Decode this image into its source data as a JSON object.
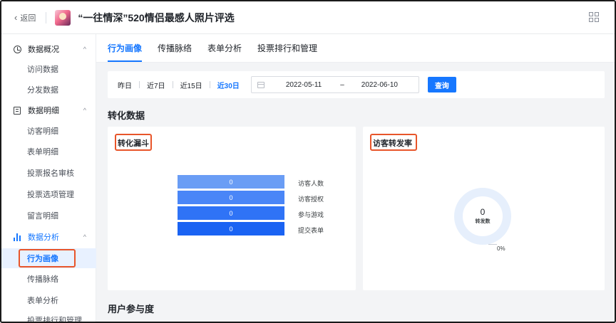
{
  "header": {
    "back_label": "返回",
    "title": "“一往情深”520情侣最感人照片评选"
  },
  "sidebar": {
    "groups": [
      {
        "label": "数据概况",
        "items": [
          "访问数据",
          "分发数据"
        ]
      },
      {
        "label": "数据明细",
        "items": [
          "访客明细",
          "表单明细",
          "投票报名审核",
          "投票选项管理",
          "留言明细"
        ]
      },
      {
        "label": "数据分析",
        "items": [
          "行为画像",
          "传播脉络",
          "表单分析",
          "投票排行和管理"
        ]
      }
    ],
    "selected_item": "行为画像"
  },
  "tabs": [
    {
      "label": "行为画像",
      "active": true
    },
    {
      "label": "传播脉络",
      "active": false
    },
    {
      "label": "表单分析",
      "active": false
    },
    {
      "label": "投票排行和管理",
      "active": false
    }
  ],
  "filter": {
    "quick_ranges": [
      "昨日",
      "近7日",
      "近15日",
      "近30日"
    ],
    "active_range": "近30日",
    "start_date": "2022-05-11",
    "separator": "–",
    "end_date": "2022-06-10",
    "query_label": "查询"
  },
  "sections": {
    "conversion_title": "转化数据",
    "engagement_title": "用户参与度"
  },
  "funnel": {
    "title": "转化漏斗",
    "steps": [
      {
        "label": "访客人数",
        "value": "0",
        "color": "#6a9df5"
      },
      {
        "label": "访客授权",
        "value": "0",
        "color": "#4a86f7"
      },
      {
        "label": "参与游戏",
        "value": "0",
        "color": "#2f73f6"
      },
      {
        "label": "提交表单",
        "value": "0",
        "color": "#1a63f3"
      }
    ]
  },
  "share_rate": {
    "title": "访客转发率",
    "value": "0",
    "value_label": "转发数",
    "percent": "0%"
  },
  "colors": {
    "accent": "#1677ff",
    "highlight": "#e8552a"
  }
}
